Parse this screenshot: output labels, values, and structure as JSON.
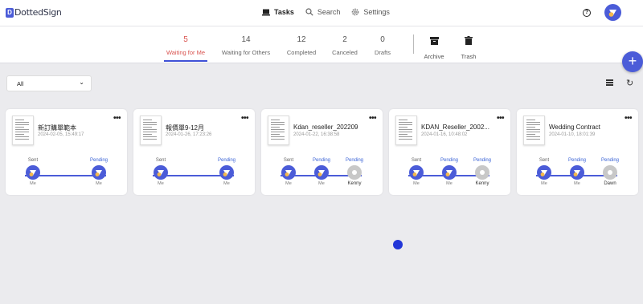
{
  "app": {
    "logo_text": "DottedSign",
    "logo_mark": "D"
  },
  "nav": [
    {
      "label": "Tasks",
      "icon": "laptop-icon",
      "active": true
    },
    {
      "label": "Search",
      "icon": "search-icon"
    },
    {
      "label": "Settings",
      "icon": "gear-icon"
    }
  ],
  "status_tabs": [
    {
      "count": "5",
      "label": "Waiting for Me",
      "active": true
    },
    {
      "count": "14",
      "label": "Waiting for Others"
    },
    {
      "count": "12",
      "label": "Completed"
    },
    {
      "count": "2",
      "label": "Canceled"
    },
    {
      "count": "0",
      "label": "Drafts"
    }
  ],
  "actions": {
    "archive": "Archive",
    "trash": "Trash"
  },
  "filter": {
    "value": "All"
  },
  "cards": [
    {
      "name": "新訂購單範本",
      "date": "2024-02-05, 15:49:17",
      "signers": [
        {
          "status": "Sent",
          "name": "Me"
        },
        {
          "status": "Pending",
          "name": "Me"
        }
      ]
    },
    {
      "name": "報價單9-12月",
      "date": "2024-01-26, 17:23:26",
      "signers": [
        {
          "status": "Sent",
          "name": "Me"
        },
        {
          "status": "Pending",
          "name": "Me"
        }
      ]
    },
    {
      "name": "Kdan_reseller_202209",
      "date": "2024-01-22, 16:38:58",
      "signers": [
        {
          "status": "Sent",
          "name": "Me"
        },
        {
          "status": "Pending",
          "name": "Me"
        },
        {
          "status": "Pending",
          "name": "Kenny"
        }
      ]
    },
    {
      "name": "KDAN_Reseller_2002...",
      "date": "2024-01-16, 10:48:02",
      "signers": [
        {
          "status": "Sent",
          "name": "Me"
        },
        {
          "status": "Pending",
          "name": "Me"
        },
        {
          "status": "Pending",
          "name": "Kenny"
        }
      ]
    },
    {
      "name": "Wedding Contract",
      "date": "2024-01-10, 18:01:39",
      "signers": [
        {
          "status": "Sent",
          "name": "Me"
        },
        {
          "status": "Pending",
          "name": "Me"
        },
        {
          "status": "Pending",
          "name": "Dawn"
        }
      ]
    }
  ],
  "colors": {
    "brand": "#4b5cd8",
    "active_tab": "#d9534f",
    "pending": "#3a63d6"
  }
}
